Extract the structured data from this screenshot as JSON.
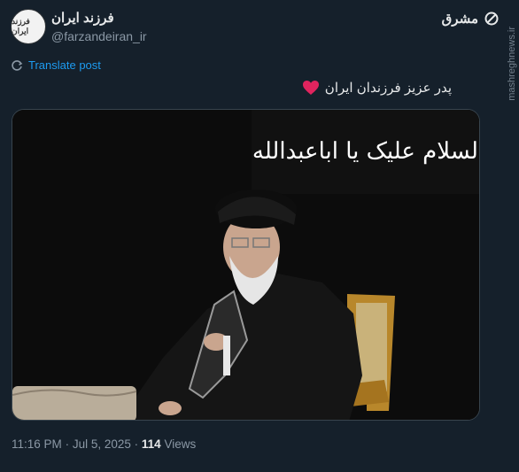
{
  "header": {
    "display_name": "فرزند ایران",
    "handle": "@farzandeiran_ir",
    "avatar_text": "فرزند ایران",
    "brand_text": "مشرق"
  },
  "translate_label": "Translate post",
  "post": {
    "text": "پدر عزیز فرزندان ایران",
    "emoji": "❤️"
  },
  "photo": {
    "banner_text": "السلام علیک یا اباعبدالله"
  },
  "meta": {
    "time": "11:16 PM",
    "date": "Jul 5, 2025",
    "views_count": "114",
    "views_label": "Views"
  },
  "watermark": "mashreghnews.ir",
  "colors": {
    "background": "#15202b",
    "link": "#1d9bf0",
    "muted": "#8b98a5"
  }
}
